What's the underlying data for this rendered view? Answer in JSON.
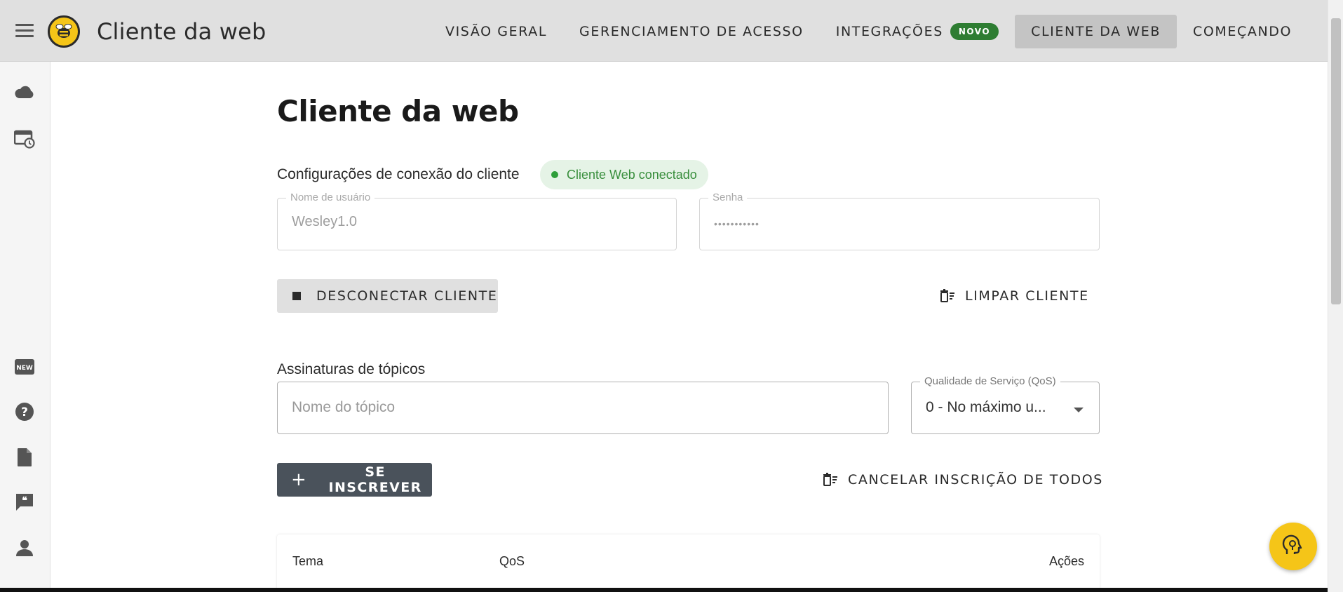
{
  "appbar": {
    "title": "Cliente da web",
    "nav": [
      {
        "label": "VISÃO GERAL",
        "active": false
      },
      {
        "label": "GERENCIAMENTO DE ACESSO",
        "active": false
      },
      {
        "label": "INTEGRAÇÕES",
        "active": false,
        "badge": "NOVO"
      },
      {
        "label": "CLIENTE DA WEB",
        "active": true
      },
      {
        "label": "COMEÇANDO",
        "active": false
      }
    ]
  },
  "rail": {
    "icons": [
      "cloud-icon",
      "calendar-clock-icon",
      "new-icon",
      "help-icon",
      "document-icon",
      "quote-icon",
      "person-icon"
    ]
  },
  "page": {
    "title": "Cliente da web",
    "connection": {
      "label": "Configurações de conexão do cliente",
      "status": "Cliente Web conectado",
      "username_label": "Nome de usuário",
      "username_value": "Wesley1.0",
      "password_label": "Senha",
      "password_value": "•••••••••••",
      "disconnect_label": "DESCONECTAR CLIENTE",
      "clear_label": "LIMPAR CLIENTE"
    },
    "subscriptions": {
      "label": "Assinaturas de tópicos",
      "topic_placeholder": "Nome do tópico",
      "qos_label": "Qualidade de Serviço (QoS)",
      "qos_value": "0 - No máximo u...",
      "subscribe_label": "SE INSCREVER",
      "unsubscribe_all_label": "CANCELAR INSCRIÇÃO DE TODOS"
    },
    "table": {
      "columns": [
        "Tema",
        "QoS",
        "Ações"
      ]
    }
  },
  "colors": {
    "appbar": "#e0e0e0",
    "accent_yellow": "#f5c518",
    "status_green": "#388e3c",
    "subscribe_button": "#4a525b"
  }
}
